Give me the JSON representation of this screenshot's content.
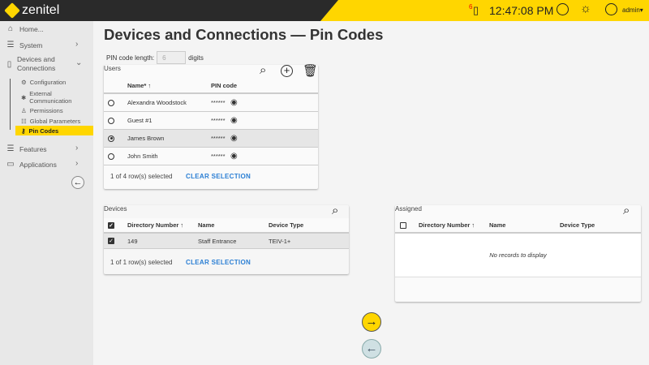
{
  "app": {
    "brand": "zenitel",
    "clock": "12:47:08 PM",
    "notification_count": "6",
    "user": "admin"
  },
  "sidebar": {
    "home": "Home...",
    "system": "System",
    "devices": "Devices and Connections",
    "sub": [
      "Configuration",
      "External Communication",
      "Permissions",
      "Global Parameters",
      "Pin Codes"
    ],
    "features": "Features",
    "applications": "Applications"
  },
  "page": {
    "title": "Devices and Connections — Pin Codes",
    "pin_label": "PIN code length:",
    "pin_value": "6",
    "pin_suffix": "digits"
  },
  "users": {
    "title": "Users",
    "col_name": "Name* ↑",
    "col_pin": "PIN code",
    "rows": [
      {
        "name": "Alexandra Woodstock",
        "pin": "******",
        "selected": false
      },
      {
        "name": "Guest #1",
        "pin": "******",
        "selected": false
      },
      {
        "name": "James Brown",
        "pin": "******",
        "selected": true
      },
      {
        "name": "John Smith",
        "pin": "******",
        "selected": false
      }
    ],
    "status": "1 of 4 row(s) selected",
    "clear": "CLEAR SELECTION"
  },
  "devices": {
    "title": "Devices",
    "cols": [
      "Directory Number ↑",
      "Name",
      "Device Type"
    ],
    "rows": [
      {
        "dir": "149",
        "name": "Staff Entrance",
        "type": "TEIV-1+"
      }
    ],
    "status": "1 of 1 row(s) selected",
    "clear": "CLEAR SELECTION"
  },
  "assigned": {
    "title": "Assigned",
    "cols": [
      "Directory Number ↑",
      "Name",
      "Device Type"
    ],
    "empty": "No records to display"
  },
  "colors": {
    "accent": "#ffd600",
    "dark": "#2a2a2a",
    "link": "#2b7fd4"
  }
}
